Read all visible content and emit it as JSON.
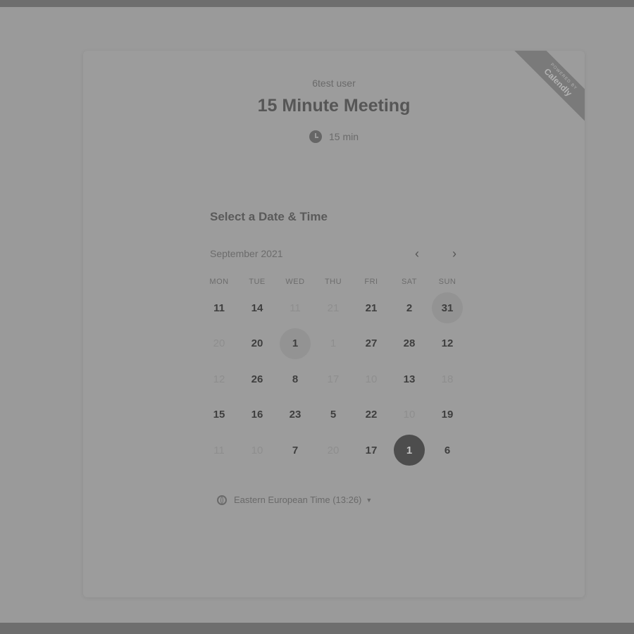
{
  "badge": {
    "top": "POWERED BY",
    "brand": "Calendly"
  },
  "event": {
    "owner": "6test user",
    "title": "15 Minute Meeting",
    "duration": "15 min"
  },
  "calendar": {
    "heading": "Select a Date & Time",
    "month": "September 2021",
    "weekdays": [
      "MON",
      "TUE",
      "WED",
      "THU",
      "FRI",
      "SAT",
      "SUN"
    ],
    "weeks": [
      [
        {
          "d": "11",
          "s": "avail"
        },
        {
          "d": "14",
          "s": "avail"
        },
        {
          "d": "11",
          "s": "muted"
        },
        {
          "d": "21",
          "s": "muted"
        },
        {
          "d": "21",
          "s": "avail"
        },
        {
          "d": "2",
          "s": "avail"
        },
        {
          "d": "31",
          "s": "avail ring"
        }
      ],
      [
        {
          "d": "20",
          "s": "muted"
        },
        {
          "d": "20",
          "s": "avail"
        },
        {
          "d": "1",
          "s": "avail ring"
        },
        {
          "d": "1",
          "s": "muted"
        },
        {
          "d": "27",
          "s": "avail"
        },
        {
          "d": "28",
          "s": "avail"
        },
        {
          "d": "12",
          "s": "avail"
        }
      ],
      [
        {
          "d": "12",
          "s": "muted"
        },
        {
          "d": "26",
          "s": "avail"
        },
        {
          "d": "8",
          "s": "avail"
        },
        {
          "d": "17",
          "s": "muted"
        },
        {
          "d": "10",
          "s": "muted"
        },
        {
          "d": "13",
          "s": "avail"
        },
        {
          "d": "18",
          "s": "muted"
        }
      ],
      [
        {
          "d": "15",
          "s": "avail"
        },
        {
          "d": "16",
          "s": "avail"
        },
        {
          "d": "23",
          "s": "avail"
        },
        {
          "d": "5",
          "s": "avail"
        },
        {
          "d": "22",
          "s": "avail"
        },
        {
          "d": "10",
          "s": "muted"
        },
        {
          "d": "19",
          "s": "avail"
        }
      ],
      [
        {
          "d": "11",
          "s": "muted"
        },
        {
          "d": "10",
          "s": "muted"
        },
        {
          "d": "7",
          "s": "avail"
        },
        {
          "d": "20",
          "s": "muted"
        },
        {
          "d": "17",
          "s": "avail"
        },
        {
          "d": "1",
          "s": "selected"
        },
        {
          "d": "6",
          "s": "avail"
        }
      ]
    ]
  },
  "timezone": {
    "label": "Eastern European Time (13:26)"
  },
  "icons": {
    "prev": "chevron-left-icon",
    "next": "chevron-right-icon",
    "clock": "clock-icon",
    "globe": "globe-icon",
    "caret": "caret-down-icon"
  }
}
